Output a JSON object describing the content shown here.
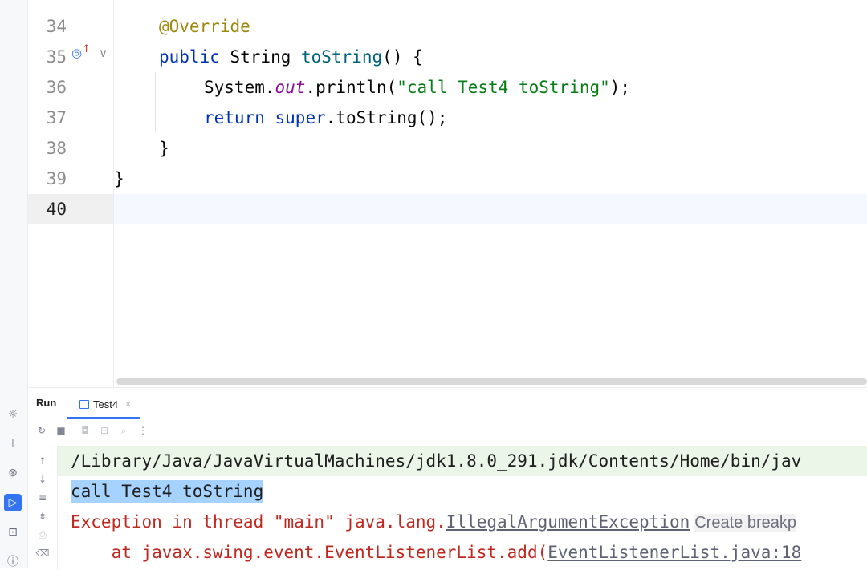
{
  "tool_strip": {
    "icons": [
      "debug-icon",
      "build-icon",
      "services-icon",
      "run-icon",
      "terminal-icon",
      "problems-icon"
    ]
  },
  "editor": {
    "line_numbers": [
      "34",
      "35",
      "36",
      "37",
      "38",
      "39",
      "40"
    ],
    "lines": {
      "l34": {
        "annotation": "@Override"
      },
      "l35": {
        "kw": "public",
        "type": " String ",
        "fn": "toString",
        "rest": "() {"
      },
      "l36": {
        "pre": "System.",
        "field": "out",
        "mid": ".println(",
        "str": "\"call Test4 toString\"",
        "end": ");"
      },
      "l37": {
        "kw1": "return",
        "sp": " ",
        "kw2": "super",
        "rest": ".toString();"
      },
      "l38": {
        "text": "}"
      },
      "l39": {
        "text": "}"
      }
    }
  },
  "run_panel": {
    "title": "Run",
    "tab_label": "Test4",
    "tab_close": "×"
  },
  "console": {
    "command": "/Library/Java/JavaVirtualMachines/jdk1.8.0_291.jdk/Contents/Home/bin/jav",
    "output": "call Test4 toString",
    "error_prefix": "Exception in thread \"main\" java.lang.",
    "error_link": "IllegalArgumentException",
    "error_hint": "Create breakp",
    "stack_prefix": "    at javax.swing.event.EventListenerList.add(",
    "stack_link": "EventListenerList.java:18"
  },
  "colors": {
    "accent": "#3574f0",
    "error": "#c0271f",
    "keyword": "#0033b3",
    "string": "#067d17",
    "annotation": "#9e880d"
  }
}
